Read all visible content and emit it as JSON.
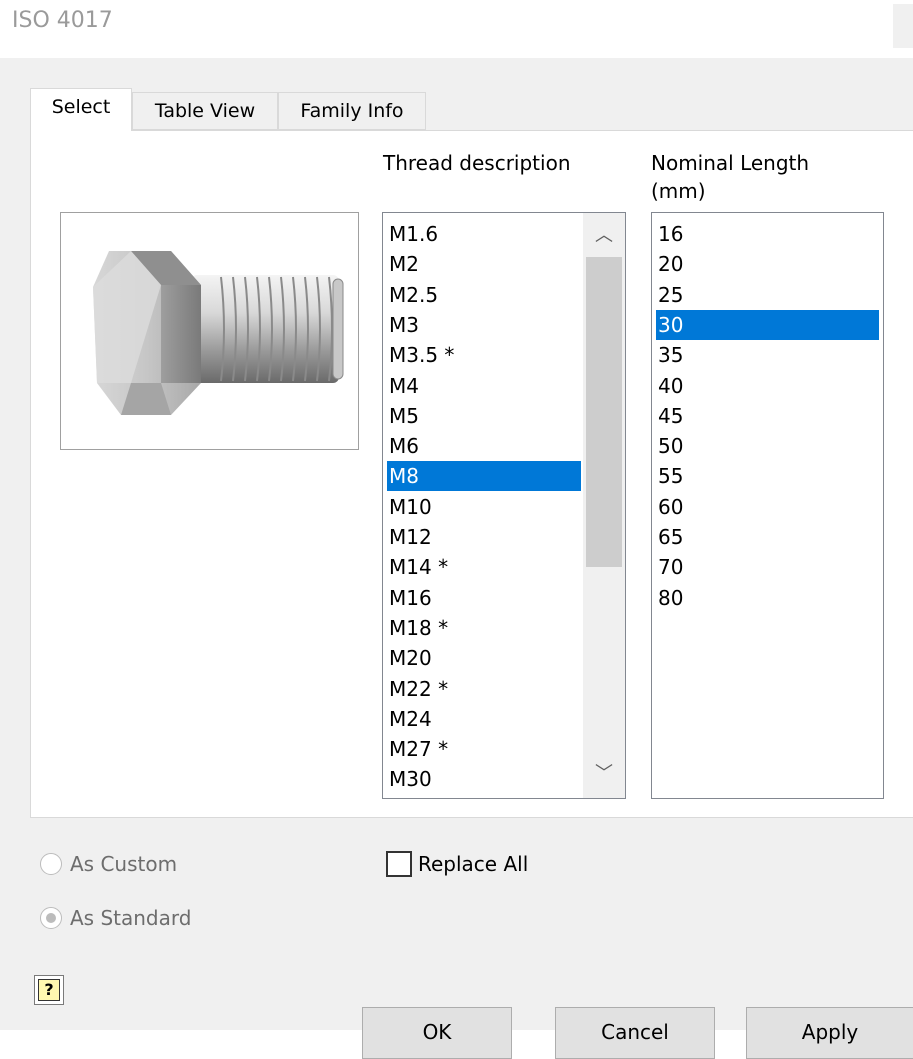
{
  "window": {
    "title": "ISO 4017"
  },
  "tabs": [
    {
      "label": "Select",
      "active": true
    },
    {
      "label": "Table View",
      "active": false
    },
    {
      "label": "Family Info",
      "active": false
    }
  ],
  "select_tab": {
    "thread_header": "Thread description",
    "length_header_line1": "Nominal Length",
    "length_header_line2": "(mm)",
    "thread_items": [
      "M1.6",
      "M2",
      "M2.5",
      "M3",
      "M3.5 *",
      "M4",
      "M5",
      "M6",
      "M8",
      "M10",
      "M12",
      "M14 *",
      "M16",
      "M18 *",
      "M20",
      "M22 *",
      "M24",
      "M27 *",
      "M30"
    ],
    "thread_selected": "M8",
    "length_items": [
      "16",
      "20",
      "25",
      "30",
      "35",
      "40",
      "45",
      "50",
      "55",
      "60",
      "65",
      "70",
      "80"
    ],
    "length_selected": "30"
  },
  "options": {
    "as_custom_label": "As Custom",
    "as_standard_label": "As Standard",
    "as_custom_checked": false,
    "as_standard_checked": true,
    "replace_all_label": "Replace All",
    "replace_all_checked": false
  },
  "buttons": {
    "help_glyph": "?",
    "ok": "OK",
    "cancel": "Cancel",
    "apply": "Apply"
  },
  "colors": {
    "selection": "#0078d7",
    "dialog_bg": "#f0f0f0"
  },
  "icons": {
    "part_preview": "hex-bolt-icon",
    "scroll_up": "chevron-up-icon",
    "scroll_down": "chevron-down-icon",
    "help": "help-icon"
  }
}
